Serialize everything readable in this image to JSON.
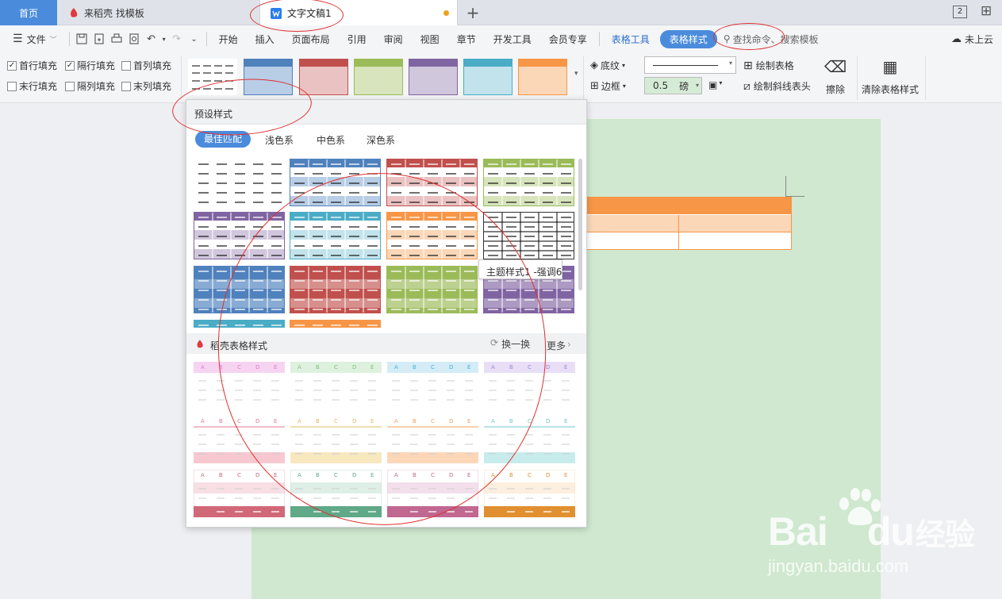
{
  "tabs": {
    "home": "首页",
    "daoke": "来稻壳 找模板",
    "doc": "文字文稿1",
    "add": "+"
  },
  "window_controls": {
    "layout": "2",
    "grid": "⊞"
  },
  "menu": {
    "file": "文件",
    "items": [
      "开始",
      "插入",
      "页面布局",
      "引用",
      "审阅",
      "视图",
      "章节",
      "开发工具",
      "会员专享"
    ],
    "table_tools": "表格工具",
    "table_style": "表格样式",
    "search": "查找命令、搜索模板",
    "cloud": "未上云"
  },
  "ribbon": {
    "checkboxes": [
      {
        "label": "首行填充",
        "checked": true
      },
      {
        "label": "隔行填充",
        "checked": true
      },
      {
        "label": "首列填充",
        "checked": false
      },
      {
        "label": "末行填充",
        "checked": false
      },
      {
        "label": "隔列填充",
        "checked": false
      },
      {
        "label": "末列填充",
        "checked": false
      }
    ],
    "shading": "底纹",
    "border": "边框",
    "line_width": "0.5",
    "line_unit": "磅",
    "draw_table": "绘制表格",
    "draw_diagonal": "绘制斜线表头",
    "erase": "擦除",
    "clear_style": "清除表格样式"
  },
  "popup": {
    "header": "预设样式",
    "filters": [
      "最佳匹配",
      "浅色系",
      "中色系",
      "深色系"
    ],
    "tooltip": "主题样式1 -强调6",
    "daoke_header": "稻壳表格样式",
    "refresh": "换一换",
    "more": "更多",
    "col_letters": [
      "A",
      "B",
      "C",
      "D",
      "E"
    ]
  },
  "colors": {
    "accent_blue": "#4a8bdc",
    "blue": "#4f81bd",
    "red": "#c0504d",
    "green": "#9bbb59",
    "purple": "#8064a2",
    "aqua": "#4bacc6",
    "orange": "#f79646",
    "annotation": "#e03030"
  },
  "watermark": {
    "brand": "Bai",
    "brand2": "du",
    "cn": "经验",
    "url": "jingyan.baidu.com"
  }
}
